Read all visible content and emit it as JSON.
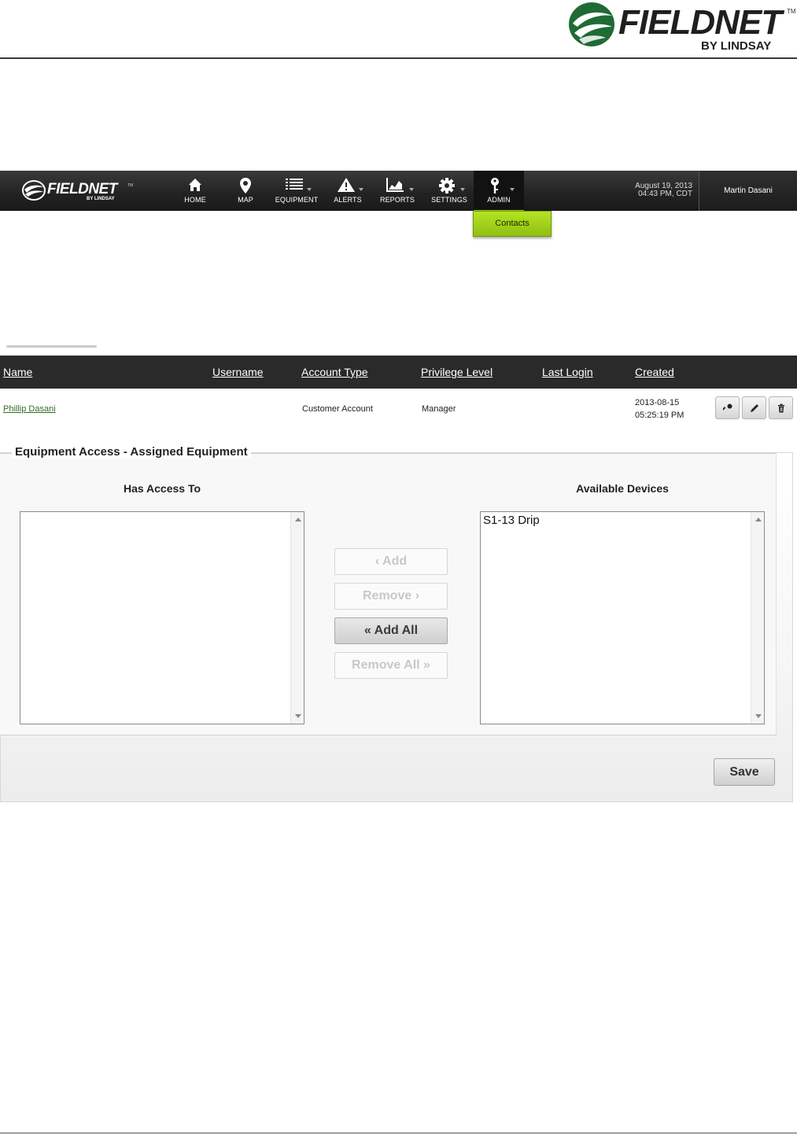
{
  "document": {
    "logo_brand": "FIELDNET",
    "logo_tm": "TM",
    "logo_byline": "BY LINDSAY"
  },
  "navbar": {
    "logo_brand": "FIELDNET",
    "logo_tm": "TM",
    "logo_byline": "BY LINDSAY",
    "items": [
      {
        "label": "HOME",
        "icon": "home-icon"
      },
      {
        "label": "MAP",
        "icon": "map-pin-icon"
      },
      {
        "label": "EQUIPMENT",
        "icon": "list-icon"
      },
      {
        "label": "ALERTS",
        "icon": "warning-icon"
      },
      {
        "label": "REPORTS",
        "icon": "chart-icon"
      },
      {
        "label": "SETTINGS",
        "icon": "gear-icon"
      },
      {
        "label": "ADMIN",
        "icon": "key-icon"
      }
    ],
    "active_item": "ADMIN",
    "date_line1": "August 19, 2013",
    "date_line2": "04:43 PM, CDT",
    "user_name": "Martin Dasani",
    "dropdown": [
      "Contacts"
    ],
    "accent_color": "#9ccf13"
  },
  "table": {
    "columns": [
      "Name",
      "Username",
      "Account Type",
      "Privilege Level",
      "Last Login",
      "Created"
    ],
    "rows": [
      {
        "name": "Phillip Dasani",
        "username": "",
        "account_type": "Customer Account",
        "privilege_level": "Manager",
        "last_login": "",
        "created_date": "2013-08-15",
        "created_time": "05:25:19 PM",
        "actions": [
          "key-icon",
          "pencil-icon",
          "trash-icon"
        ]
      }
    ]
  },
  "equipment_access": {
    "legend": "Equipment Access - Assigned Equipment",
    "has_access_title": "Has Access To",
    "has_access_items": [],
    "available_title": "Available Devices",
    "available_items": [
      "S1-13 Drip"
    ],
    "buttons": {
      "add": "‹ Add",
      "remove": "Remove ›",
      "add_all": "« Add All",
      "remove_all": "Remove All »"
    },
    "save_label": "Save"
  }
}
